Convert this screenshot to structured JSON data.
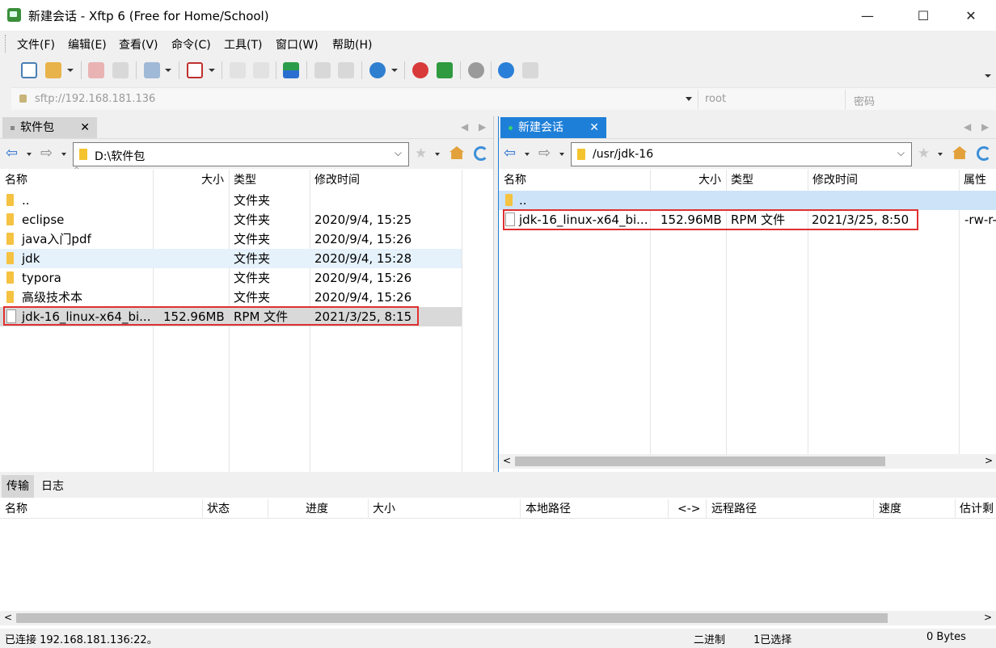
{
  "window": {
    "title": "新建会话 - Xftp 6 (Free for Home/School)",
    "minimize": "—",
    "maximize": "☐",
    "close": "✕"
  },
  "menu": [
    "文件(F)",
    "编辑(E)",
    "查看(V)",
    "命令(C)",
    "工具(T)",
    "窗口(W)",
    "帮助(H)"
  ],
  "address": {
    "url": "sftp://192.168.181.136",
    "username": "root",
    "password_placeholder": "密码"
  },
  "local": {
    "tab_label": "软件包",
    "path": "D:\\软件包",
    "columns": [
      "名称",
      "大小",
      "类型",
      "修改时间"
    ],
    "rows": [
      {
        "name": "..",
        "size": "",
        "type": "文件夹",
        "modified": "",
        "kind": "folder"
      },
      {
        "name": "eclipse",
        "size": "",
        "type": "文件夹",
        "modified": "2020/9/4, 15:25",
        "kind": "folder"
      },
      {
        "name": "java入门pdf",
        "size": "",
        "type": "文件夹",
        "modified": "2020/9/4, 15:26",
        "kind": "folder"
      },
      {
        "name": "jdk",
        "size": "",
        "type": "文件夹",
        "modified": "2020/9/4, 15:28",
        "kind": "folder"
      },
      {
        "name": "typora",
        "size": "",
        "type": "文件夹",
        "modified": "2020/9/4, 15:26",
        "kind": "folder"
      },
      {
        "name": "高级技术本",
        "size": "",
        "type": "文件夹",
        "modified": "2020/9/4, 15:26",
        "kind": "folder"
      },
      {
        "name": "jdk-16_linux-x64_bi...",
        "size": "152.96MB",
        "type": "RPM 文件",
        "modified": "2021/3/25, 8:15",
        "kind": "file"
      }
    ]
  },
  "remote": {
    "tab_label": "新建会话",
    "path": "/usr/jdk-16",
    "columns": [
      "名称",
      "大小",
      "类型",
      "修改时间",
      "属性"
    ],
    "rows": [
      {
        "name": "..",
        "size": "",
        "type": "",
        "modified": "",
        "attrs": "",
        "kind": "folder"
      },
      {
        "name": "jdk-16_linux-x64_bi...",
        "size": "152.96MB",
        "type": "RPM 文件",
        "modified": "2021/3/25, 8:50",
        "attrs": "-rw-r-",
        "kind": "file"
      }
    ]
  },
  "transfer": {
    "tabs": [
      "传输",
      "日志"
    ],
    "columns": [
      "名称",
      "状态",
      "进度",
      "大小",
      "本地路径",
      "<->",
      "远程路径",
      "速度",
      "估计剩"
    ]
  },
  "status": {
    "connected": "已连接 192.168.181.136:22。",
    "mode": "二进制",
    "selected": "1已选择",
    "bytes": "0 Bytes"
  },
  "colors": {
    "accent": "#1e7fd8",
    "highlight_row": "#e5f1fb",
    "selected_row": "#d9d9d9",
    "annotation_box": "#e03030"
  }
}
